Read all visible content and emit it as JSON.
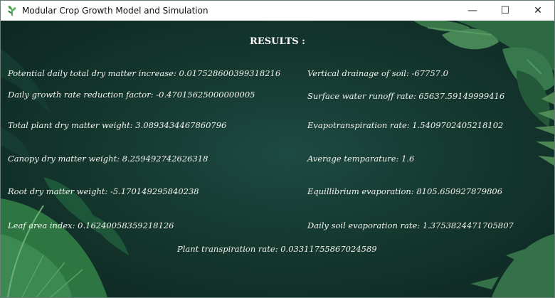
{
  "window": {
    "title": "Modular Crop Growth Model and Simulation",
    "icon": "leaf-app-icon",
    "controls": {
      "minimize": "—",
      "maximize": "☐",
      "close": "✕"
    }
  },
  "heading": "RESULTS :",
  "left_results": [
    "Potential daily total dry matter increase: 0.017528600399318216",
    "Daily growth rate reduction factor: -0.47015625000000005",
    "Total plant dry matter weight: 3.0893434467860796",
    "Canopy dry matter weight: 8.259492742626318",
    "Root dry matter weight: -5.170149295840238",
    "Leaf area index: 0.16240058359218126"
  ],
  "right_results": [
    "Vertical drainage of soil: -67757.0",
    "Surface water runoff rate: 65637.59149999416",
    "Evapotranspiration rate: 1.5409702405218102",
    "Average temparature: 1.6",
    "Equillibrium evaporation: 8105.650927879806",
    "Daily soil evaporation rate: 1.3753824471705807"
  ],
  "bottom_result": "Plant transpiration rate: 0.03311755867024589",
  "colors": {
    "background": "#15382f",
    "text": "#f2f2ec",
    "foliage": "#2f6e45"
  }
}
